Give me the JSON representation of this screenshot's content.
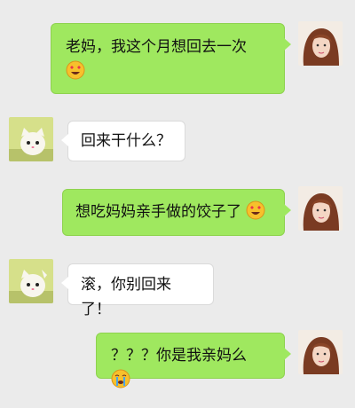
{
  "messages": [
    {
      "side": "out",
      "text": "老妈，我这个月想回去一次",
      "emoji": "heart-eyes-emoji"
    },
    {
      "side": "in",
      "text": "回来干什么？"
    },
    {
      "side": "out",
      "text": "想吃妈妈亲手做的饺子了",
      "emoji": "heart-eyes-emoji"
    },
    {
      "side": "in",
      "text": "滚，你别回来了！"
    },
    {
      "side": "out",
      "text": "？？？你是我亲妈么",
      "emoji": "crying-emoji"
    }
  ],
  "colors": {
    "background": "#ebebeb",
    "outgoing_bubble": "#9fe85f",
    "incoming_bubble": "#ffffff"
  },
  "icons": {
    "self_avatar": "girl-photo-avatar",
    "contact_avatar": "kitten-photo-avatar"
  }
}
